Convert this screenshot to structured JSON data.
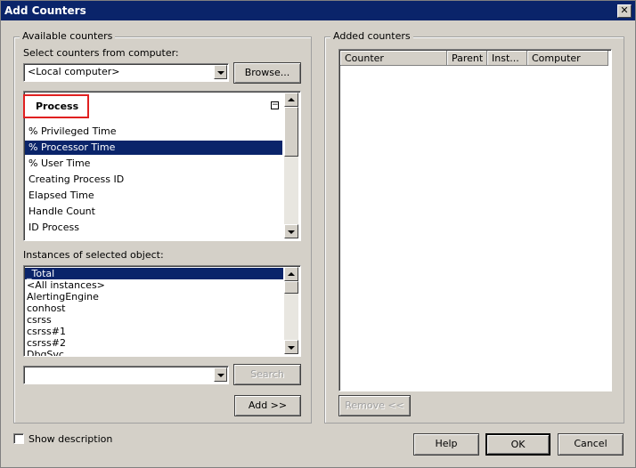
{
  "window": {
    "title": "Add Counters",
    "close_glyph": "✕"
  },
  "available": {
    "group_label": "Available counters",
    "computer_label": "Select counters from computer:",
    "computer_value": "<Local computer>",
    "browse_label": "Browse...",
    "object_header": "Process",
    "collapse_glyph": "−",
    "counters": [
      "% Privileged Time",
      "% Processor Time",
      "% User Time",
      "Creating Process ID",
      "Elapsed Time",
      "Handle Count",
      "ID Process"
    ],
    "selected_counter": "% Processor Time",
    "instances_label": "Instances of selected object:",
    "instances": [
      "_Total",
      "<All instances>",
      "AlertingEngine",
      "conhost",
      "csrss",
      "csrss#1",
      "csrss#2",
      "DbgSvc"
    ],
    "selected_instance": "_Total",
    "search_value": "",
    "search_label": "Search",
    "add_label": "Add >>"
  },
  "added": {
    "group_label": "Added counters",
    "columns": [
      "Counter",
      "Parent",
      "Inst...",
      "Computer"
    ],
    "remove_label": "Remove <<"
  },
  "footer": {
    "show_description_label": "Show description",
    "show_description_checked": false,
    "help_label": "Help",
    "ok_label": "OK",
    "cancel_label": "Cancel"
  }
}
